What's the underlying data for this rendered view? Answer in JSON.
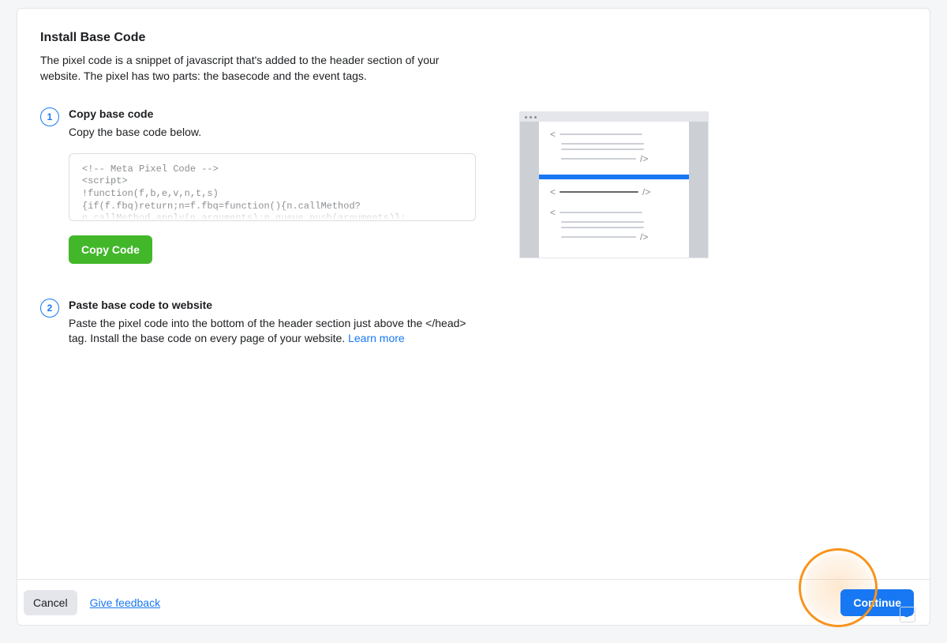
{
  "header": {
    "title": "Install Base Code",
    "description": "The pixel code is a snippet of javascript that's added to the header section of your website. The pixel has two parts: the basecode and the event tags."
  },
  "steps": [
    {
      "num": "1",
      "title": "Copy base code",
      "desc": "Copy the base code below.",
      "code": "<!-- Meta Pixel Code -->\n<script>\n!function(f,b,e,v,n,t,s)\n{if(f.fbq)return;n=f.fbq=function(){n.callMethod?\nn.callMethod.apply(n,arguments):n.queue.push(arguments)};",
      "copy_label": "Copy Code"
    },
    {
      "num": "2",
      "title": "Paste base code to website",
      "desc": "Paste the pixel code into the bottom of the header section just above the </head> tag. Install the base code on every page of your website. ",
      "learn_more": "Learn more"
    }
  ],
  "footer": {
    "cancel": "Cancel",
    "feedback": "Give feedback",
    "continue": "Continue"
  }
}
